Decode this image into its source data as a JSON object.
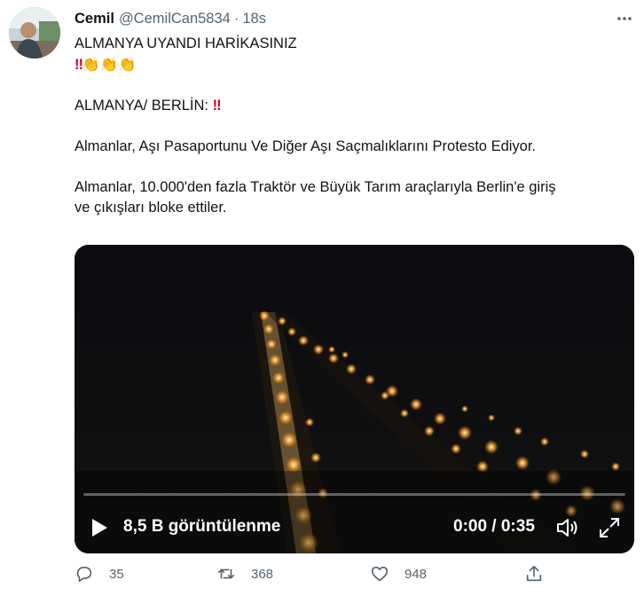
{
  "tweet": {
    "display_name": "Cemil",
    "handle": "@CemilCan5834",
    "separator": "·",
    "time": "18s",
    "line1": "ALMANYA UYANDI HARİKASINIZ",
    "line2_bangs": "‼",
    "line2_emoji": "👏👏👏",
    "line3": "ALMANYA/ BERLİN:",
    "line3_bangs": "‼",
    "line4": "Almanlar, Aşı Pasaportunu Ve Diğer Aşı Saçmalıklarını Protesto Ediyor.",
    "line5a": "Almanlar, 10.000'den fazla Traktör ve Büyük Tarım araçlarıyla Berlin'e giriş",
    "line5b": "ve çıkışları bloke ettiler."
  },
  "video": {
    "views": "8,5 B görüntülenme",
    "timecode": "0:00 / 0:35",
    "progress": 0
  },
  "actions": {
    "reply_count": "35",
    "retweet_count": "368",
    "like_count": "948"
  },
  "colors": {
    "text": "#0f1419",
    "muted": "#536471",
    "video_bg": "#050505"
  }
}
